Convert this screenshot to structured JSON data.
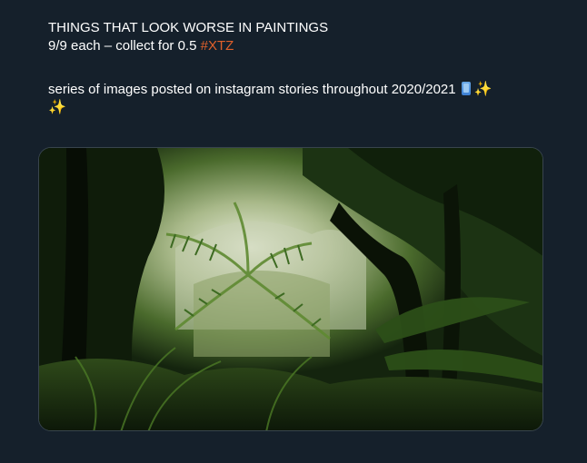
{
  "tweet": {
    "line1": "THINGS THAT LOOK WORSE IN PAINTINGS",
    "line2_prefix": "9/9 each – collect for 0.5 ",
    "hashtag": "#XTZ",
    "line3": "series of images posted on instagram stories throughout 2020/2021",
    "emojis": [
      "mobile-phone-icon",
      "sparkles-icon",
      "sparkles-icon"
    ]
  },
  "media": {
    "type": "photo",
    "subject": "jungle foliage"
  },
  "colors": {
    "background": "#15202b",
    "text": "#ffffff",
    "hashtag": "#e0602b",
    "card_border": "#38444d"
  }
}
